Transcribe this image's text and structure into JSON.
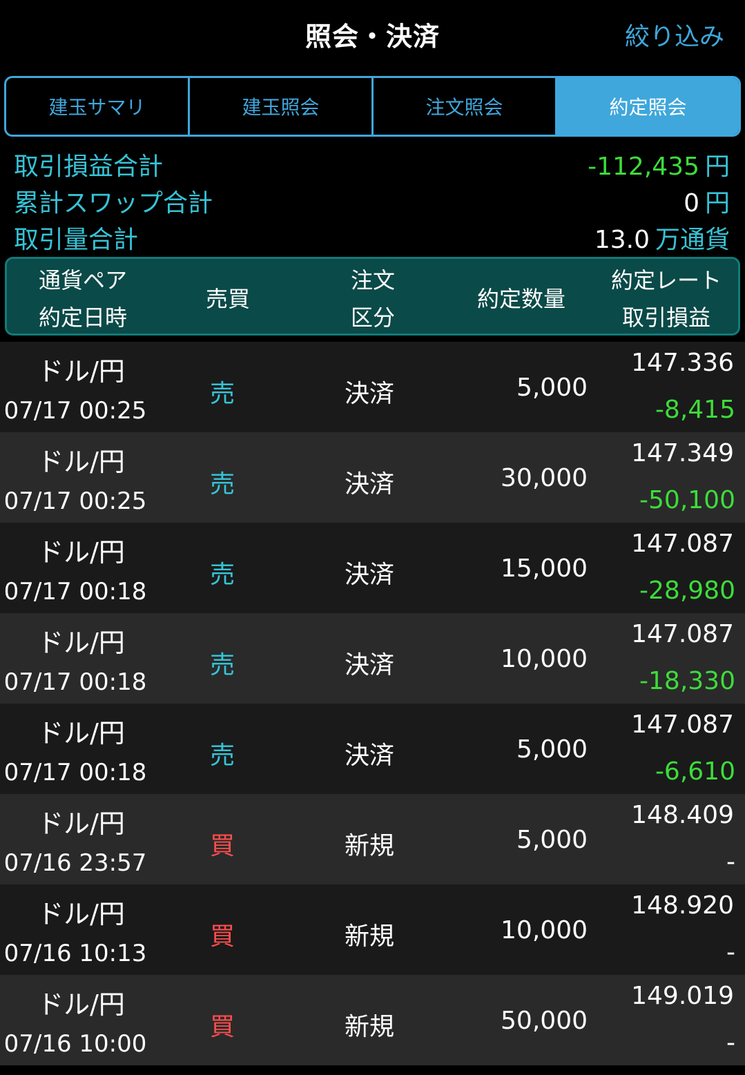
{
  "header": {
    "title": "照会・決済",
    "filter_label": "絞り込み"
  },
  "tabs": [
    {
      "label": "建玉サマリ",
      "active": false
    },
    {
      "label": "建玉照会",
      "active": false
    },
    {
      "label": "注文照会",
      "active": false
    },
    {
      "label": "約定照会",
      "active": true
    }
  ],
  "summary": {
    "pl_total": {
      "label": "取引損益合計",
      "value": "-112,435",
      "unit": "円"
    },
    "swap_total": {
      "label": "累計スワップ合計",
      "value": "0",
      "unit": "円"
    },
    "volume_total": {
      "label": "取引量合計",
      "value": "13.0",
      "unit": "万通貨"
    }
  },
  "columns": {
    "pair": "通貨ペア",
    "datetime": "約定日時",
    "side": "売買",
    "order_type_1": "注文",
    "order_type_2": "区分",
    "quantity": "約定数量",
    "rate": "約定レート",
    "pl": "取引損益"
  },
  "colors": {
    "accent_blue": "#3fa7dc",
    "label_cyan": "#36c3d6",
    "profit_green": "#3ddc3a",
    "buy_red": "#ff4d4d",
    "header_teal": "#0a4a48"
  },
  "rows": [
    {
      "pair": "ドル/円",
      "datetime": "07/17 00:25",
      "side": "売",
      "order_type": "決済",
      "quantity": "5,000",
      "rate": "147.336",
      "pl": "-8,415"
    },
    {
      "pair": "ドル/円",
      "datetime": "07/17 00:25",
      "side": "売",
      "order_type": "決済",
      "quantity": "30,000",
      "rate": "147.349",
      "pl": "-50,100"
    },
    {
      "pair": "ドル/円",
      "datetime": "07/17 00:18",
      "side": "売",
      "order_type": "決済",
      "quantity": "15,000",
      "rate": "147.087",
      "pl": "-28,980"
    },
    {
      "pair": "ドル/円",
      "datetime": "07/17 00:18",
      "side": "売",
      "order_type": "決済",
      "quantity": "10,000",
      "rate": "147.087",
      "pl": "-18,330"
    },
    {
      "pair": "ドル/円",
      "datetime": "07/17 00:18",
      "side": "売",
      "order_type": "決済",
      "quantity": "5,000",
      "rate": "147.087",
      "pl": "-6,610"
    },
    {
      "pair": "ドル/円",
      "datetime": "07/16 23:57",
      "side": "買",
      "order_type": "新規",
      "quantity": "5,000",
      "rate": "148.409",
      "pl": "-"
    },
    {
      "pair": "ドル/円",
      "datetime": "07/16 10:13",
      "side": "買",
      "order_type": "新規",
      "quantity": "10,000",
      "rate": "148.920",
      "pl": "-"
    },
    {
      "pair": "ドル/円",
      "datetime": "07/16 10:00",
      "side": "買",
      "order_type": "新規",
      "quantity": "50,000",
      "rate": "149.019",
      "pl": "-"
    }
  ]
}
